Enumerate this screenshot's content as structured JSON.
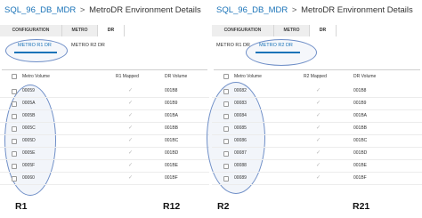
{
  "left": {
    "breadcrumb": {
      "link": "SQL_96_DB_MDR",
      "separator": ">",
      "title": "MetroDR Environment Details"
    },
    "tabs": [
      "CONFIGURATION",
      "METRO",
      "DR"
    ],
    "subtabs": [
      "METRO R1 DR",
      "METRO R2 DR"
    ],
    "columns": [
      "Metro Volume",
      "R1 Mapped",
      "DR Volume"
    ],
    "rows": [
      {
        "metro": "00059",
        "dr": "001B8"
      },
      {
        "metro": "0005A",
        "dr": "001B9"
      },
      {
        "metro": "0005B",
        "dr": "001BA"
      },
      {
        "metro": "0005C",
        "dr": "001BB"
      },
      {
        "metro": "0005D",
        "dr": "001BC"
      },
      {
        "metro": "0005E",
        "dr": "001BD"
      },
      {
        "metro": "0005F",
        "dr": "001BE"
      },
      {
        "metro": "00060",
        "dr": "001BF"
      }
    ],
    "mapped_checks": [
      "✓",
      "✓",
      "✓",
      "✓",
      "✓",
      "✓",
      "✓",
      "✓"
    ],
    "label_metro": "R1",
    "label_dr": "R12"
  },
  "right": {
    "breadcrumb": {
      "link": "SQL_96_DB_MDR",
      "separator": ">",
      "title": "MetroDR Environment Details"
    },
    "tabs": [
      "CONFIGURATION",
      "METRO",
      "DR"
    ],
    "subtabs": [
      "METRO R1 DR",
      "METRO R2 DR"
    ],
    "columns": [
      "Metro Volume",
      "R2 Mapped",
      "DR Volume"
    ],
    "rows": [
      {
        "metro": "00082",
        "dr": "001B8"
      },
      {
        "metro": "00083",
        "dr": "001B9"
      },
      {
        "metro": "00084",
        "dr": "001BA"
      },
      {
        "metro": "00085",
        "dr": "001BB"
      },
      {
        "metro": "00086",
        "dr": "001BC"
      },
      {
        "metro": "00087",
        "dr": "001BD"
      },
      {
        "metro": "00088",
        "dr": "001BE"
      },
      {
        "metro": "00089",
        "dr": "001BF"
      }
    ],
    "mapped_checks": [
      "✓",
      "✓",
      "✓",
      "✓",
      "✓",
      "✓",
      "✓",
      "✓"
    ],
    "label_metro": "R2",
    "label_dr": "R21"
  },
  "colors": {
    "link": "#1a73b8",
    "highlight_oval": "#6e8ec7",
    "tab_bg": "#eeeeee"
  }
}
